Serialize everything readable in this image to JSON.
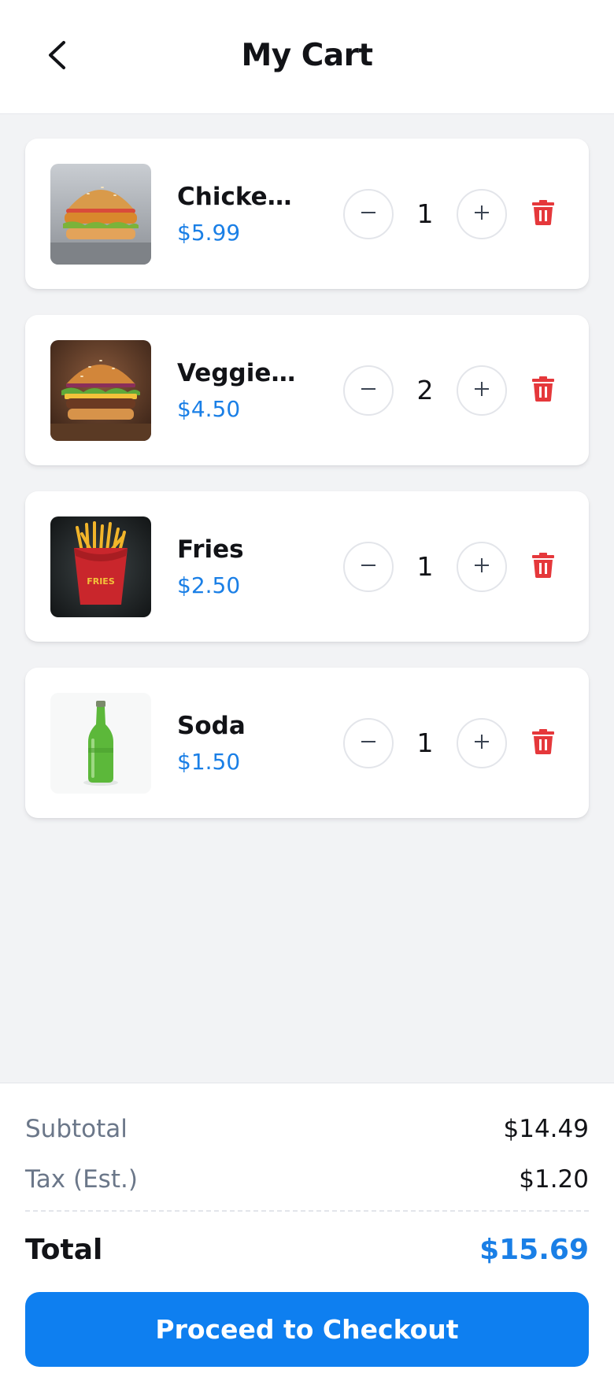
{
  "header": {
    "title": "My Cart",
    "back_icon": "chevron-left-icon"
  },
  "cart": {
    "items": [
      {
        "name": "Chicken Burger",
        "price": "$5.99",
        "quantity": "1",
        "image": "chicken-burger-photo"
      },
      {
        "name": "Veggie Burger",
        "price": "$4.50",
        "quantity": "2",
        "image": "veggie-burger-photo"
      },
      {
        "name": "Fries",
        "price": "$2.50",
        "quantity": "1",
        "image": "fries-photo",
        "image_text": "FRIES"
      },
      {
        "name": "Soda",
        "price": "$1.50",
        "quantity": "1",
        "image": "soda-bottle-photo"
      }
    ],
    "icons": {
      "decrease": "minus-icon",
      "increase": "plus-icon",
      "remove": "trash-icon"
    }
  },
  "summary": {
    "subtotal_label": "Subtotal",
    "subtotal_value": "$14.49",
    "tax_label": "Tax (Est.)",
    "tax_value": "$1.20",
    "total_label": "Total",
    "total_value": "$15.69",
    "checkout_label": "Proceed to Checkout"
  },
  "colors": {
    "accent": "#0e7ff0",
    "price": "#1a7fe6",
    "delete": "#e5383b",
    "background": "#f2f3f5"
  }
}
